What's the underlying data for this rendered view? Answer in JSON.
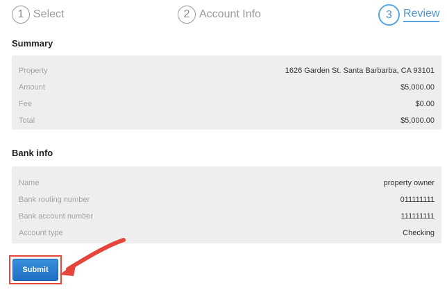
{
  "steps": [
    {
      "number": "1",
      "label": "Select"
    },
    {
      "number": "2",
      "label": "Account Info"
    },
    {
      "number": "3",
      "label": "Review"
    }
  ],
  "summary": {
    "title": "Summary",
    "rows": [
      {
        "label": "Property",
        "value": "1626 Garden St. Santa Barbarba, CA 93101"
      },
      {
        "label": "Amount",
        "value": "$5,000.00"
      },
      {
        "label": "Fee",
        "value": "$0.00"
      },
      {
        "label": "Total",
        "value": "$5,000.00"
      }
    ]
  },
  "bank": {
    "title": "Bank info",
    "rows": [
      {
        "label": "Name",
        "value": "property owner"
      },
      {
        "label": "Bank routing number",
        "value": "011111111"
      },
      {
        "label": "Bank account number",
        "value": "111111111"
      },
      {
        "label": "Account type",
        "value": "Checking"
      }
    ]
  },
  "actions": {
    "submit_label": "Submit"
  },
  "colors": {
    "accent": "#4e94d6",
    "highlight": "#e5453a",
    "panel": "#eeeeee"
  }
}
